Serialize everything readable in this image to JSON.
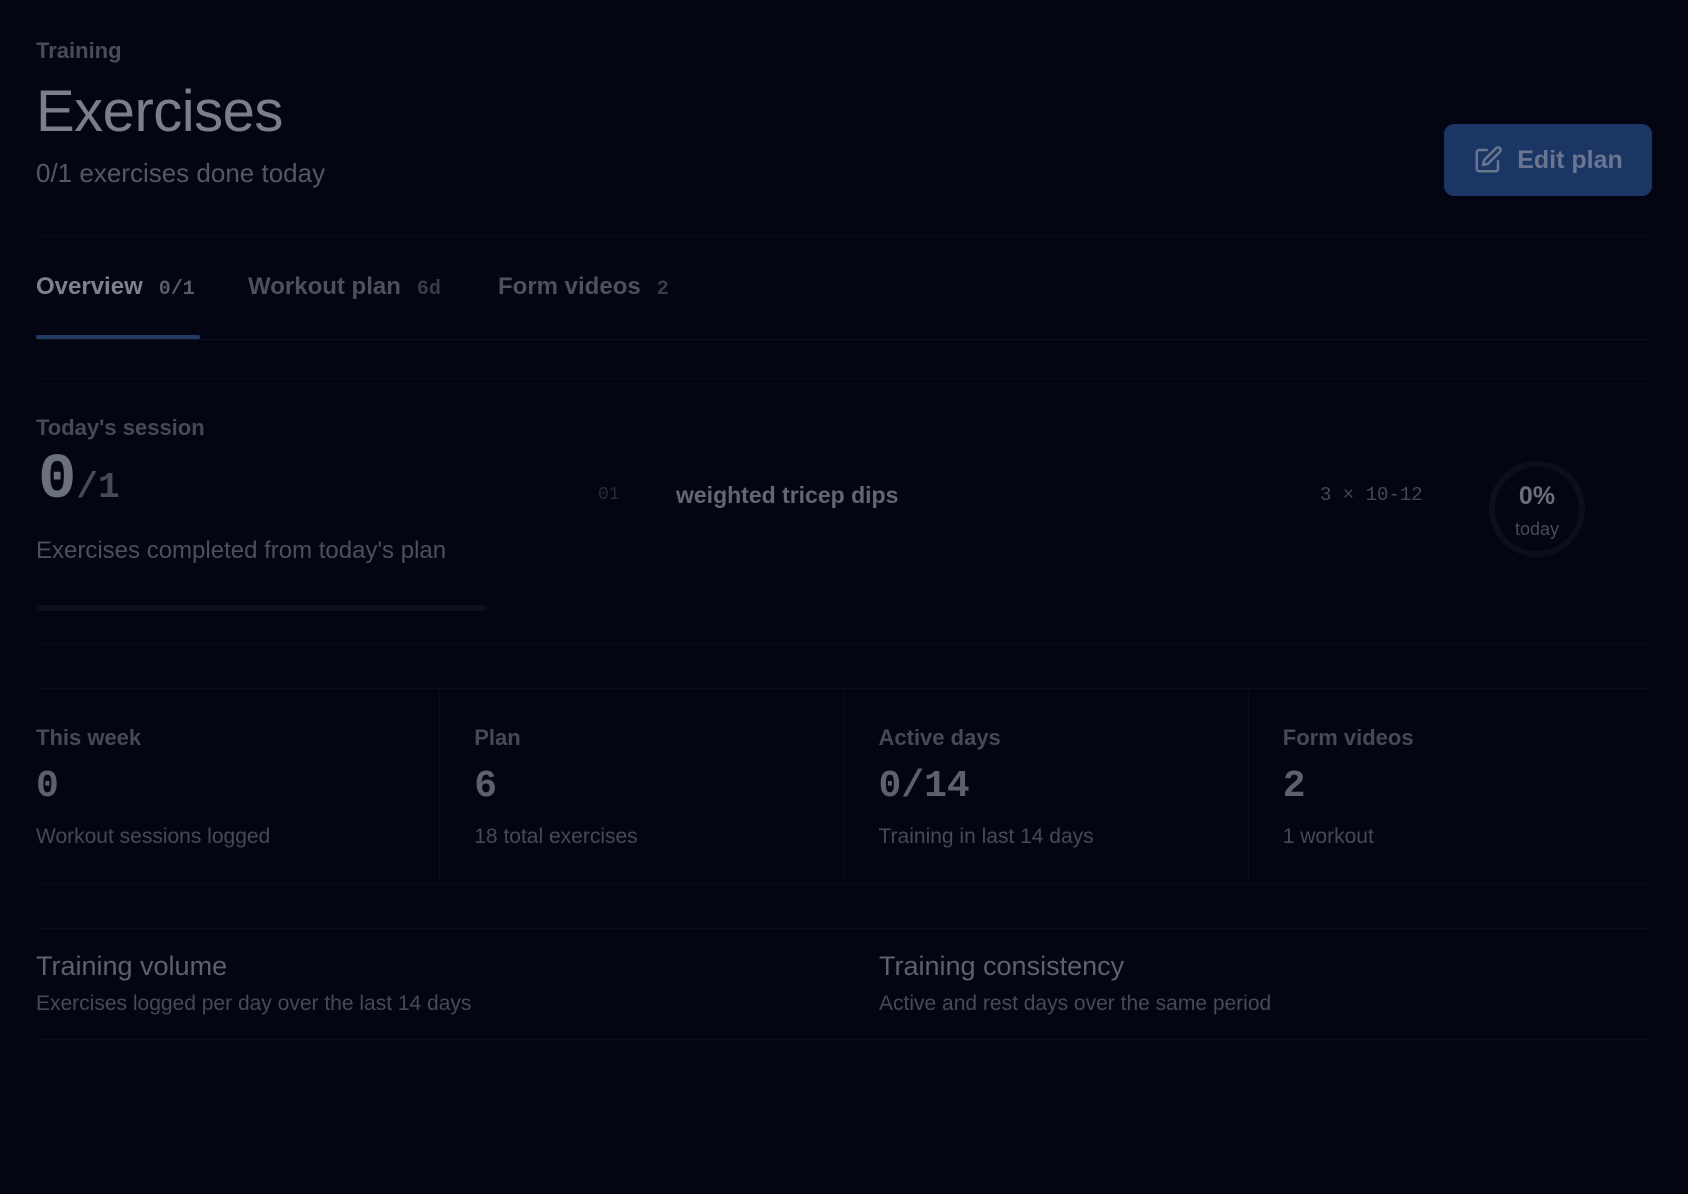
{
  "header": {
    "eyebrow": "Training",
    "title": "Exercises",
    "subtitle": "0/1 exercises done today",
    "edit_button": "Edit plan",
    "edit_icon": "edit-icon"
  },
  "tabs": [
    {
      "label": "Overview",
      "count": "0/1",
      "active": true
    },
    {
      "label": "Workout plan",
      "count": "6d",
      "active": false
    },
    {
      "label": "Form videos",
      "count": "2",
      "active": false
    }
  ],
  "session": {
    "label": "Today's session",
    "done": "0",
    "total": "/1",
    "description": "Exercises completed from today's plan",
    "progress": 0,
    "exercises": [
      {
        "num": "01",
        "name": "weighted tricep dips",
        "sets": "3 × 10-12"
      }
    ],
    "ring": {
      "percent_label": "0%",
      "sub": "today",
      "value": 0
    }
  },
  "stats": [
    {
      "label": "This week",
      "value": "0",
      "sub": "Workout sessions logged"
    },
    {
      "label": "Plan",
      "value": "6",
      "sub": "18 total exercises"
    },
    {
      "label": "Active days",
      "value": "0/14",
      "sub": "Training in last 14 days"
    },
    {
      "label": "Form videos",
      "value": "2",
      "sub": "1 workout"
    }
  ],
  "charts": [
    {
      "title": "Training volume",
      "subtitle": "Exercises logged per day over the last 14 days"
    },
    {
      "title": "Training consistency",
      "subtitle": "Active and rest days over the same period"
    }
  ],
  "colors": {
    "background": "#030612",
    "accent": "#1b3565"
  }
}
